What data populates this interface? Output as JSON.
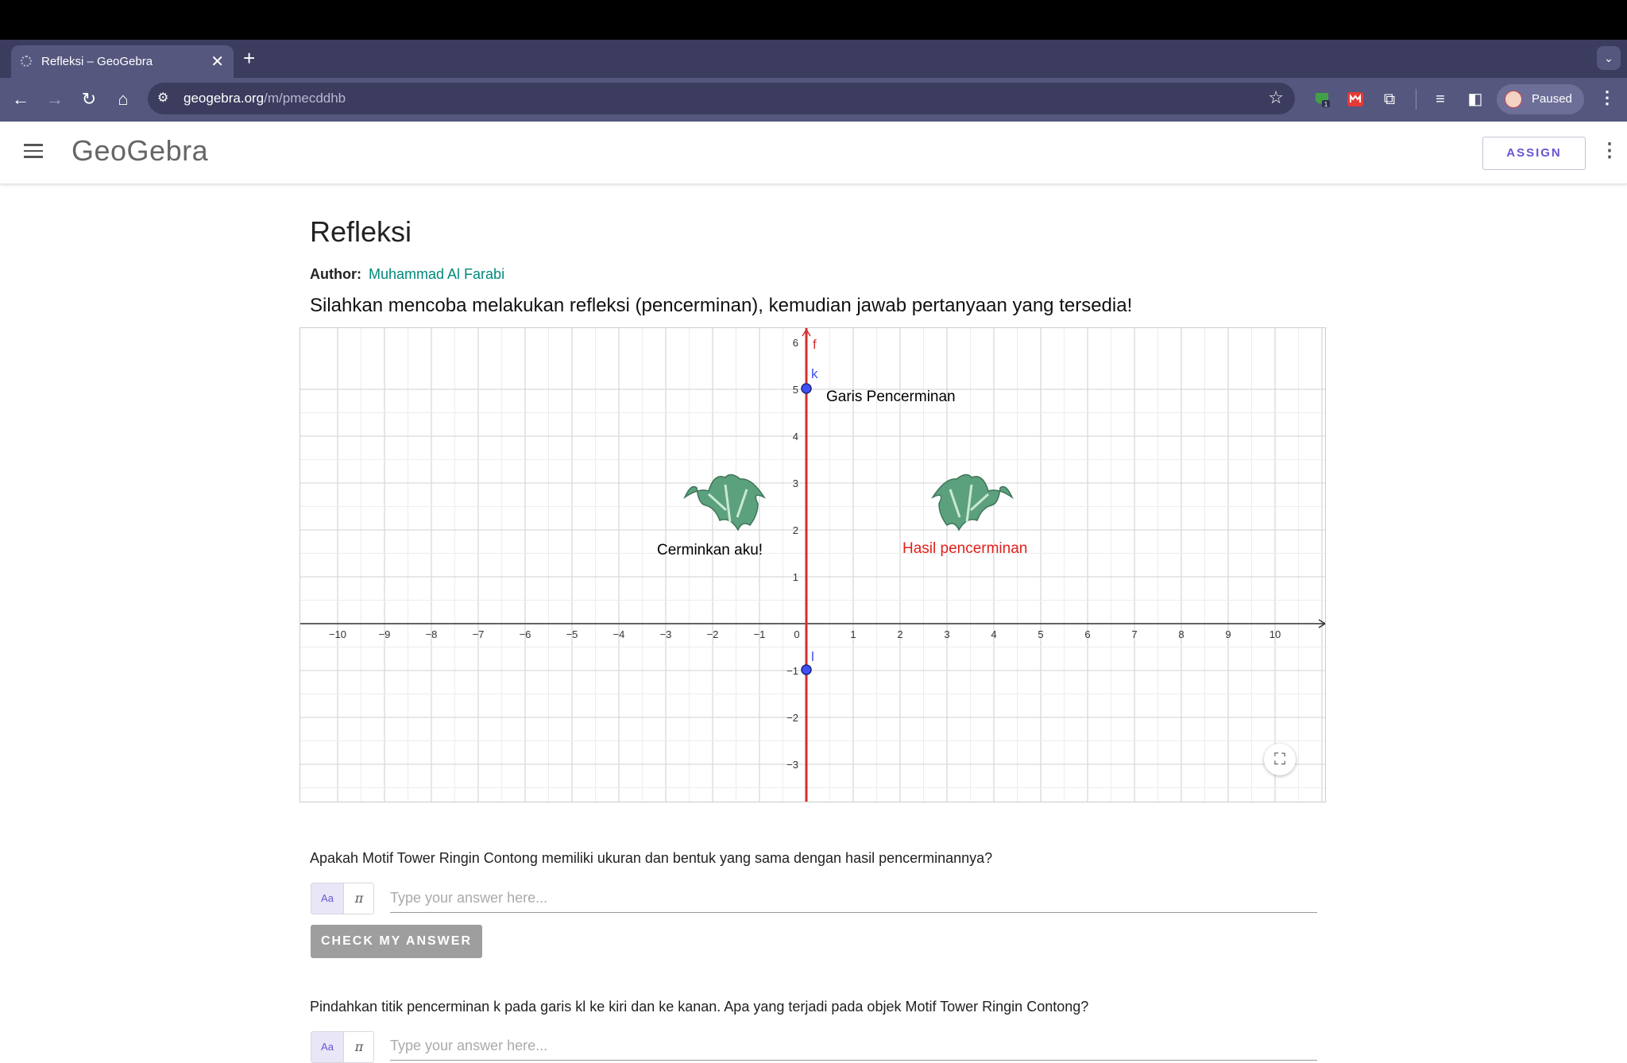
{
  "browser": {
    "tab_title": "Refleksi – GeoGebra",
    "url_host": "geogebra.org",
    "url_path": "/m/pmecddhb",
    "profile_label": "Paused",
    "extension_badge": "1"
  },
  "header": {
    "logo": "GeoGebra",
    "assign_label": "ASSIGN"
  },
  "page": {
    "title": "Refleksi",
    "author_label": "Author:",
    "author_name": "Muhammad Al Farabi",
    "instruction": "Silahkan mencoba melakukan refleksi (pencerminan), kemudian jawab pertanyaan yang tersedia!"
  },
  "applet": {
    "x_ticks": [
      "−10",
      "−9",
      "−8",
      "−7",
      "−6",
      "−5",
      "−4",
      "−3",
      "−2",
      "−1",
      "0",
      "1",
      "2",
      "3",
      "4",
      "5",
      "6",
      "7",
      "8",
      "9",
      "10"
    ],
    "y_ticks": [
      "6",
      "5",
      "4",
      "3",
      "2",
      "1",
      "−1",
      "−2",
      "−3"
    ],
    "line_label": "f",
    "point_k_label": "k",
    "point_l_label": "l",
    "mirror_line_text": "Garis Pencerminan",
    "original_label": "Cerminkan aku!",
    "result_label": "Hasil pencerminan",
    "colors": {
      "line": "#d32f2f",
      "point": "#3f51f5",
      "leaf": "#4f9a73",
      "result_text": "#e0201c"
    }
  },
  "questions": [
    {
      "text": "Apakah Motif Tower Ringin Contong memiliki ukuran dan bentuk yang sama dengan hasil pencerminannya?",
      "placeholder": "Type your answer here...",
      "button": "CHECK MY ANSWER"
    },
    {
      "text": "Pindahkan titik pencerminan k pada garis kl ke kiri dan ke kanan. Apa yang terjadi pada objek Motif Tower Ringin Contong?",
      "placeholder": "Type your answer here..."
    }
  ],
  "keyboard": {
    "text_mode": "Aa",
    "math_mode": "π"
  }
}
